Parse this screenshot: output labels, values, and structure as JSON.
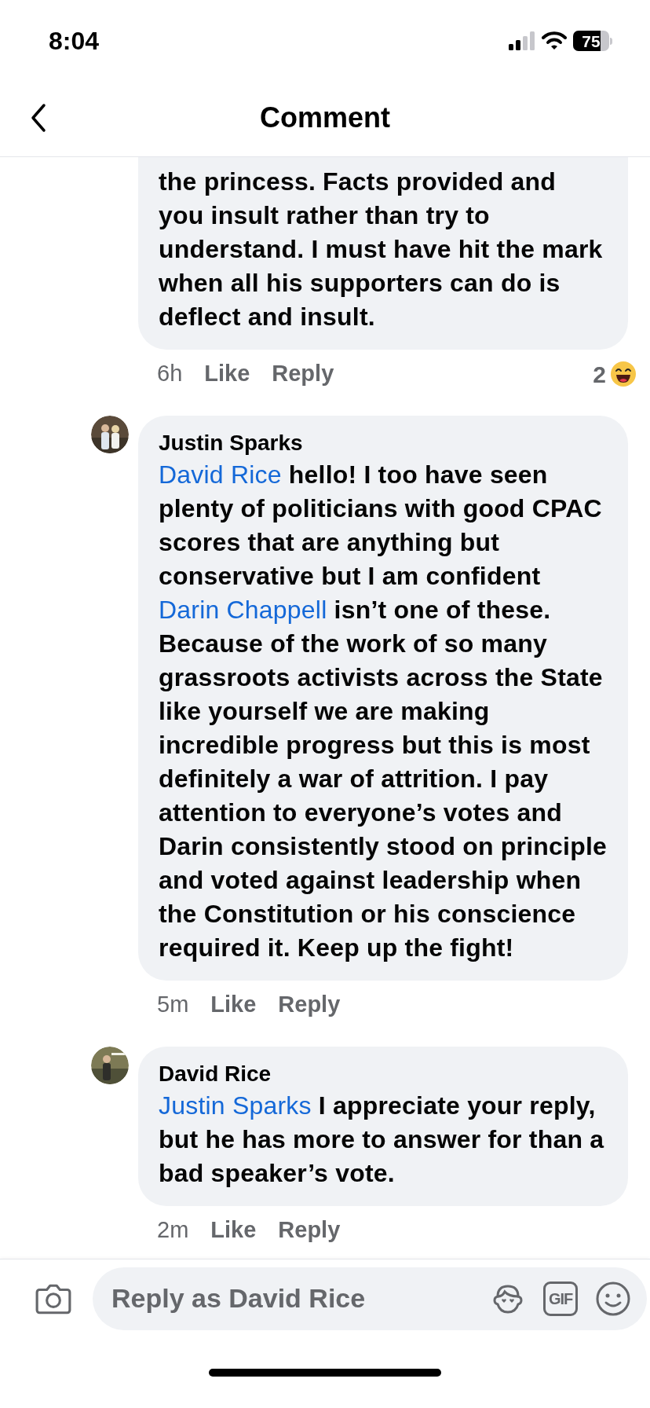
{
  "status_bar": {
    "time": "8:04",
    "battery": "75"
  },
  "header": {
    "title": "Comment"
  },
  "comments": [
    {
      "segments": [
        {
          "kind": "text",
          "text": "the princess. Facts provided and you insult rather than try to understand. I must have hit the mark when all his supporters can do is deflect and insult."
        }
      ],
      "time": "6h",
      "like": "Like",
      "reply": "Reply",
      "reactions": "2"
    },
    {
      "author": "Justin Sparks",
      "segments": [
        {
          "kind": "mention",
          "text": "David Rice"
        },
        {
          "kind": "text",
          "text": " hello! I too have seen plenty of politicians with good CPAC scores that are anything but conservative but I am confident "
        },
        {
          "kind": "mention",
          "text": "Darin Chappell"
        },
        {
          "kind": "text",
          "text": " isn’t one of these.  Because of the work of so many grassroots activists across the State like yourself we are making incredible progress but this is most definitely a war of attrition. I pay attention to everyone’s votes and Darin consistently stood on principle and voted against leadership when the Constitution or his conscience required it. Keep up the fight!"
        }
      ],
      "time": "5m",
      "like": "Like",
      "reply": "Reply"
    },
    {
      "author": "David Rice",
      "segments": [
        {
          "kind": "mention",
          "text": "Justin Sparks"
        },
        {
          "kind": "text",
          "text": " I appreciate your reply, but he has more to answer for than a bad speaker’s vote."
        }
      ],
      "time": "2m",
      "like": "Like",
      "reply": "Reply"
    }
  ],
  "composer": {
    "placeholder": "Reply as David Rice",
    "gif": "GIF"
  }
}
